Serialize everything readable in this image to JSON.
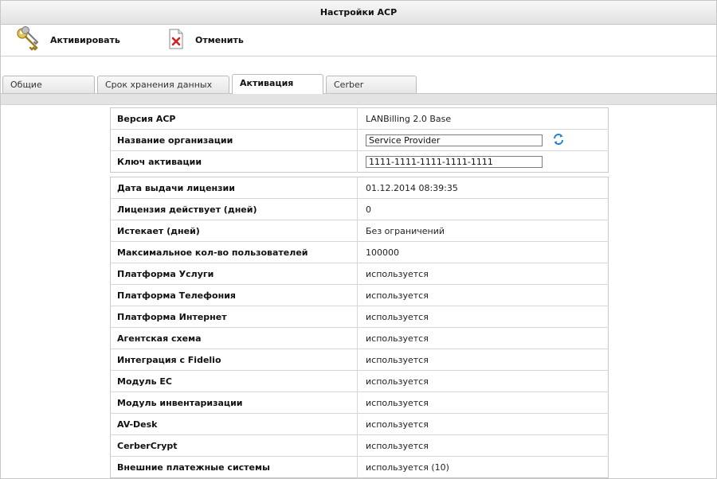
{
  "window": {
    "title": "Настройки АСР"
  },
  "toolbar": {
    "activate_label": "Активировать",
    "cancel_label": "Отменить"
  },
  "tabs": [
    {
      "label": "Общие"
    },
    {
      "label": "Срок хранения данных"
    },
    {
      "label": "Активация",
      "active": true
    },
    {
      "label": "Cerber"
    }
  ],
  "activation": {
    "version_label": "Версия АСР",
    "version_value": "LANBilling 2.0 Base",
    "org_label": "Название организации",
    "org_value": "Service Provider",
    "key_label": "Ключ активации",
    "key_value": "1111-1111-1111-1111-1111"
  },
  "license": [
    {
      "label": "Дата выдачи лицензии",
      "value": "01.12.2014 08:39:35"
    },
    {
      "label": "Лицензия действует (дней)",
      "value": "0"
    },
    {
      "label": "Истекает (дней)",
      "value": "Без ограничений"
    },
    {
      "label": "Максимальное кол-во пользователей",
      "value": "100000"
    },
    {
      "label": "Платформа Услуги",
      "value": "используется"
    },
    {
      "label": "Платформа Телефония",
      "value": "используется"
    },
    {
      "label": "Платформа Интернет",
      "value": "используется"
    },
    {
      "label": "Агентская схема",
      "value": "используется"
    },
    {
      "label": "Интеграция с Fidelio",
      "value": "используется"
    },
    {
      "label": "Модуль ЕС",
      "value": "используется"
    },
    {
      "label": "Модуль инвентаризации",
      "value": "используется"
    },
    {
      "label": "AV-Desk",
      "value": "используется"
    },
    {
      "label": "CerberCrypt",
      "value": "используется"
    },
    {
      "label": "Внешние платежные системы",
      "value": "используется (10)"
    }
  ],
  "icons": {
    "activate": "keys-icon",
    "cancel": "document-cancel-icon",
    "refresh": "refresh-icon"
  },
  "colors": {
    "cancel_red": "#d62020",
    "refresh_blue": "#2c7fd0",
    "key_gold": "#d8b43a"
  }
}
